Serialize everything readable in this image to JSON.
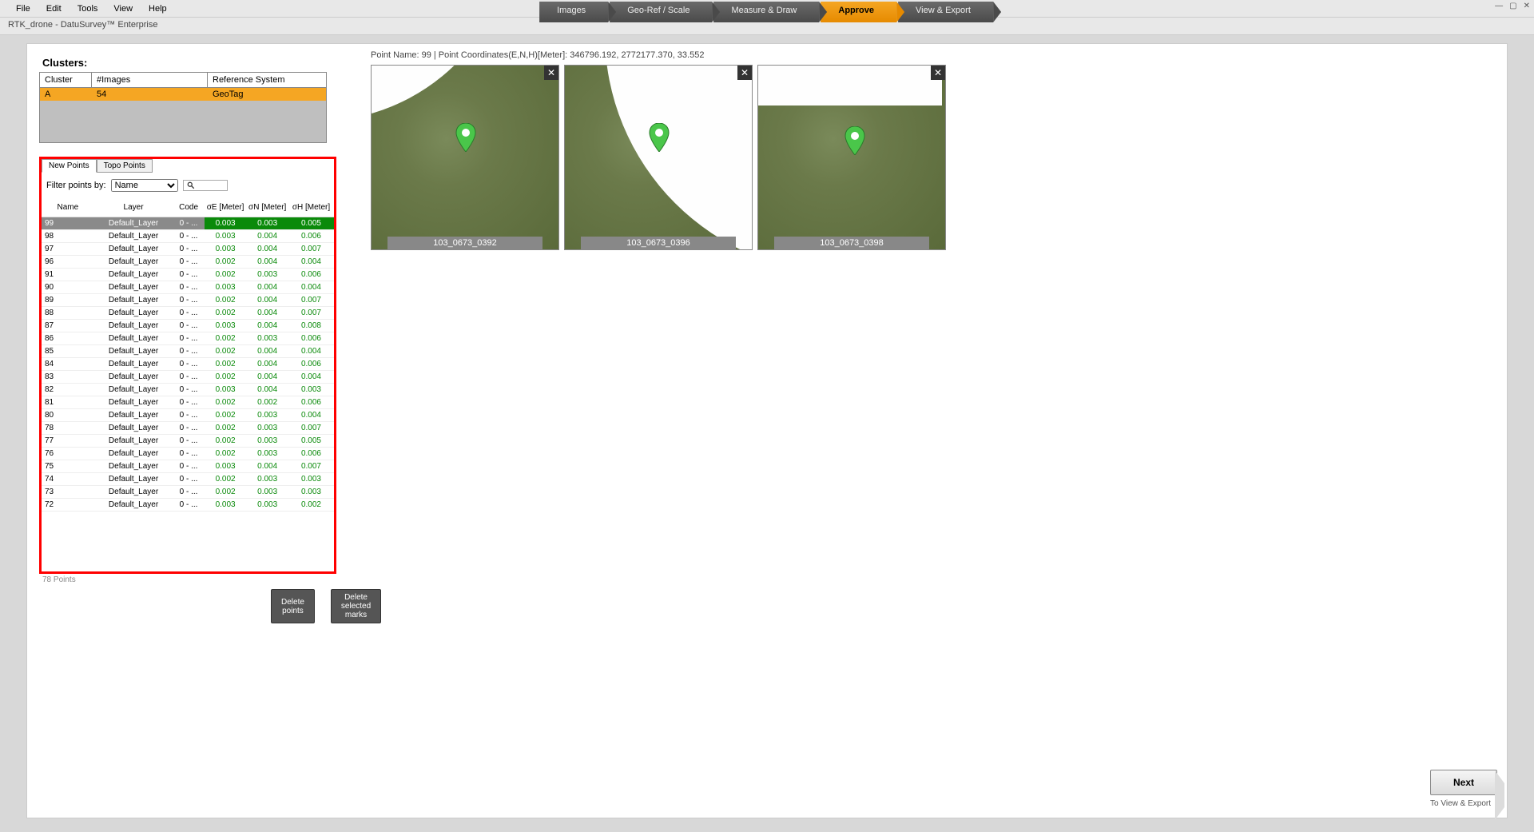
{
  "menu": {
    "file": "File",
    "edit": "Edit",
    "tools": "Tools",
    "view": "View",
    "help": "Help"
  },
  "title": "RTK_drone - DatuSurvey™ Enterprise",
  "steps": {
    "images": "Images",
    "georef": "Geo-Ref / Scale",
    "measure": "Measure & Draw",
    "approve": "Approve",
    "viewexport": "View & Export"
  },
  "clusters": {
    "title": "Clusters:",
    "headers": {
      "cluster": "Cluster",
      "images": "#Images",
      "ref": "Reference System"
    },
    "row": {
      "cluster": "A",
      "images": "54",
      "ref": "GeoTag"
    }
  },
  "tabs": {
    "new": "New Points",
    "topo": "Topo Points"
  },
  "filter": {
    "label": "Filter points by:",
    "option": "Name"
  },
  "points_headers": {
    "name": "Name",
    "layer": "Layer",
    "code": "Code",
    "sE": "σE [Meter]",
    "sN": "σN [Meter]",
    "sH": "σH [Meter]"
  },
  "points": [
    {
      "name": "99",
      "layer": "Default_Layer",
      "code": "0 - ...",
      "sE": "0.003",
      "sN": "0.003",
      "sH": "0.005",
      "selected": true
    },
    {
      "name": "98",
      "layer": "Default_Layer",
      "code": "0 - ...",
      "sE": "0.003",
      "sN": "0.004",
      "sH": "0.006"
    },
    {
      "name": "97",
      "layer": "Default_Layer",
      "code": "0 - ...",
      "sE": "0.003",
      "sN": "0.004",
      "sH": "0.007"
    },
    {
      "name": "96",
      "layer": "Default_Layer",
      "code": "0 - ...",
      "sE": "0.002",
      "sN": "0.004",
      "sH": "0.004"
    },
    {
      "name": "91",
      "layer": "Default_Layer",
      "code": "0 - ...",
      "sE": "0.002",
      "sN": "0.003",
      "sH": "0.006"
    },
    {
      "name": "90",
      "layer": "Default_Layer",
      "code": "0 - ...",
      "sE": "0.003",
      "sN": "0.004",
      "sH": "0.004"
    },
    {
      "name": "89",
      "layer": "Default_Layer",
      "code": "0 - ...",
      "sE": "0.002",
      "sN": "0.004",
      "sH": "0.007"
    },
    {
      "name": "88",
      "layer": "Default_Layer",
      "code": "0 - ...",
      "sE": "0.002",
      "sN": "0.004",
      "sH": "0.007"
    },
    {
      "name": "87",
      "layer": "Default_Layer",
      "code": "0 - ...",
      "sE": "0.003",
      "sN": "0.004",
      "sH": "0.008"
    },
    {
      "name": "86",
      "layer": "Default_Layer",
      "code": "0 - ...",
      "sE": "0.002",
      "sN": "0.003",
      "sH": "0.006"
    },
    {
      "name": "85",
      "layer": "Default_Layer",
      "code": "0 - ...",
      "sE": "0.002",
      "sN": "0.004",
      "sH": "0.004"
    },
    {
      "name": "84",
      "layer": "Default_Layer",
      "code": "0 - ...",
      "sE": "0.002",
      "sN": "0.004",
      "sH": "0.006"
    },
    {
      "name": "83",
      "layer": "Default_Layer",
      "code": "0 - ...",
      "sE": "0.002",
      "sN": "0.004",
      "sH": "0.004"
    },
    {
      "name": "82",
      "layer": "Default_Layer",
      "code": "0 - ...",
      "sE": "0.003",
      "sN": "0.004",
      "sH": "0.003"
    },
    {
      "name": "81",
      "layer": "Default_Layer",
      "code": "0 - ...",
      "sE": "0.002",
      "sN": "0.002",
      "sH": "0.006"
    },
    {
      "name": "80",
      "layer": "Default_Layer",
      "code": "0 - ...",
      "sE": "0.002",
      "sN": "0.003",
      "sH": "0.004"
    },
    {
      "name": "78",
      "layer": "Default_Layer",
      "code": "0 - ...",
      "sE": "0.002",
      "sN": "0.003",
      "sH": "0.007"
    },
    {
      "name": "77",
      "layer": "Default_Layer",
      "code": "0 - ...",
      "sE": "0.002",
      "sN": "0.003",
      "sH": "0.005"
    },
    {
      "name": "76",
      "layer": "Default_Layer",
      "code": "0 - ...",
      "sE": "0.002",
      "sN": "0.003",
      "sH": "0.006"
    },
    {
      "name": "75",
      "layer": "Default_Layer",
      "code": "0 - ...",
      "sE": "0.003",
      "sN": "0.004",
      "sH": "0.007"
    },
    {
      "name": "74",
      "layer": "Default_Layer",
      "code": "0 - ...",
      "sE": "0.002",
      "sN": "0.003",
      "sH": "0.003"
    },
    {
      "name": "73",
      "layer": "Default_Layer",
      "code": "0 - ...",
      "sE": "0.002",
      "sN": "0.003",
      "sH": "0.003"
    },
    {
      "name": "72",
      "layer": "Default_Layer",
      "code": "0 - ...",
      "sE": "0.003",
      "sN": "0.003",
      "sH": "0.002"
    }
  ],
  "points_count": "78 Points",
  "buttons": {
    "delete_points": "Delete points",
    "delete_marks": "Delete selected marks",
    "next": "Next",
    "next_sub": "To View & Export"
  },
  "point_info": "Point Name: 99 | Point Coordinates(E,N,H)[Meter]: 346796.192, 2772177.370, 33.552",
  "thumbs": [
    {
      "label": "103_0673_0392"
    },
    {
      "label": "103_0673_0396"
    },
    {
      "label": "103_0673_0398"
    }
  ]
}
